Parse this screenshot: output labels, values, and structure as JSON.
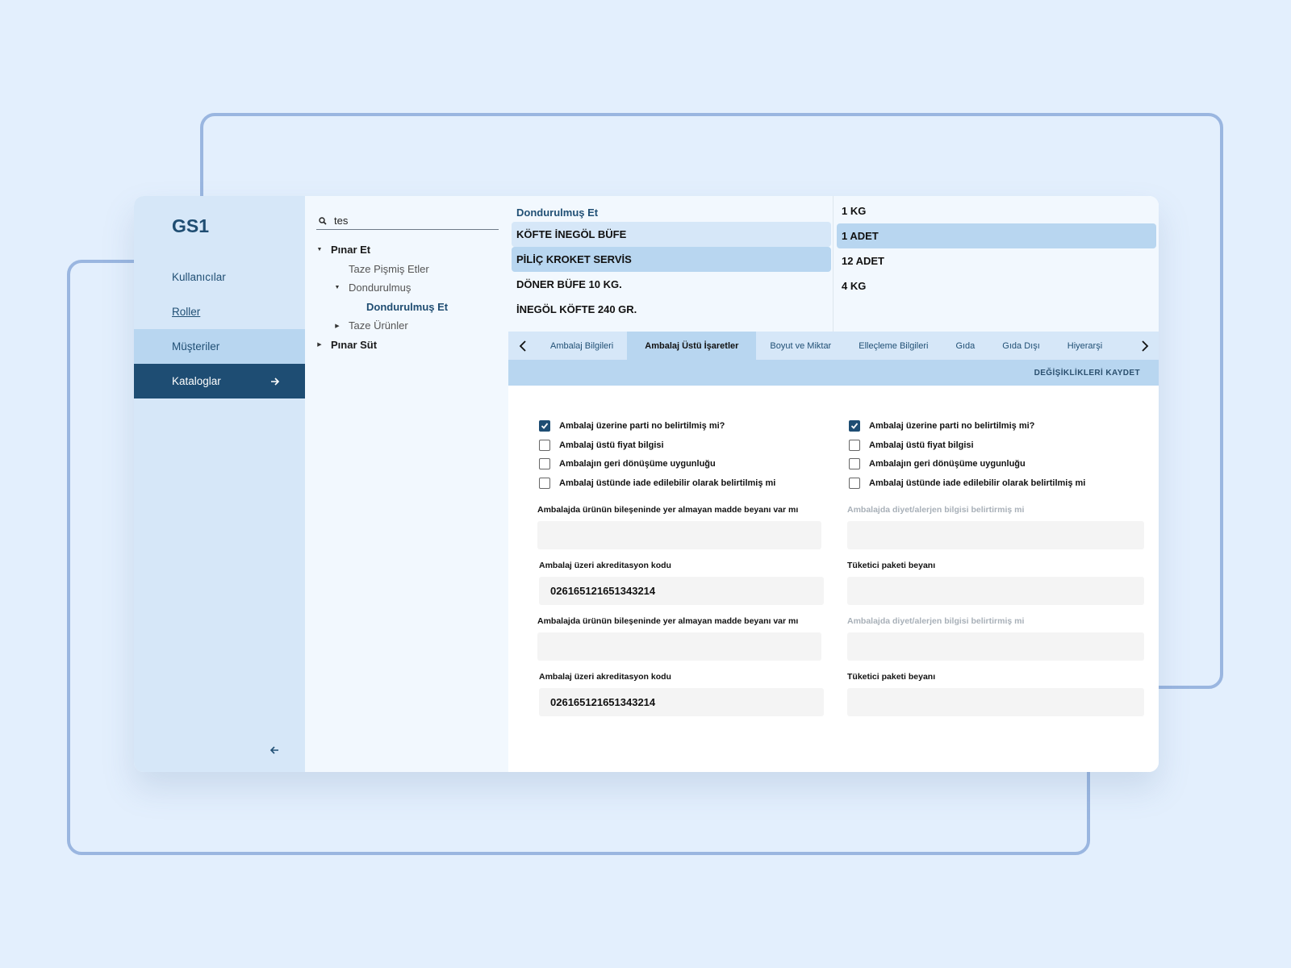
{
  "app": {
    "logo": "GS1"
  },
  "sidebar": {
    "items": [
      {
        "label": "Kullanıcılar"
      },
      {
        "label": "Roller"
      },
      {
        "label": "Müşteriler"
      },
      {
        "label": "Kataloglar"
      }
    ]
  },
  "search": {
    "value": "tes"
  },
  "tree": {
    "nodes": [
      {
        "label": "Pınar Et"
      },
      {
        "label": "Taze Pişmiş Etler"
      },
      {
        "label": "Dondurulmuş"
      },
      {
        "label": "Dondurulmuş Et"
      },
      {
        "label": "Taze Ürünler"
      },
      {
        "label": "Pınar Süt"
      }
    ]
  },
  "products": {
    "category": "Dondurulmuş Et",
    "items": [
      "KÖFTE İNEGÖL BÜFE",
      "PİLİÇ KROKET SERVİS",
      "DÖNER BÜFE 10 KG.",
      "İNEGÖL KÖFTE 240 GR."
    ]
  },
  "packages": {
    "items": [
      "1 KG",
      "1 ADET",
      "12 ADET",
      "4 KG"
    ]
  },
  "tabs": [
    "Ambalaj Bilgileri",
    "Ambalaj Üstü İşaretler",
    "Boyut ve Miktar",
    "Elleçleme Bilgileri",
    "Gıda",
    "Gıda Dışı",
    "Hiyerarşi"
  ],
  "save_label": "DEĞİŞİKLİKLERİ KAYDET",
  "form": {
    "checks": [
      "Ambalaj üzerine parti no belirtilmiş mi?",
      "Ambalaj üstü fiyat bilgisi",
      "Ambalajın geri dönüşüme uygunluğu",
      "Ambalaj üstünde iade edilebilir olarak belirtilmiş mi"
    ],
    "fields": {
      "ingredient_label": "Ambalajda ürünün bileşeninde yer almayan madde beyanı var mı",
      "allergen_label": "Ambalajda diyet/alerjen bilgisi belirtirmiş mi",
      "accreditation_label": "Ambalaj üzeri akreditasyon kodu",
      "accreditation_value": "026165121651343214",
      "consumer_label": "Tüketici paketi beyanı"
    }
  },
  "colors": {
    "accent": "#1e4d73",
    "light": "#d6e7f8",
    "mid": "#b8d6f0"
  }
}
